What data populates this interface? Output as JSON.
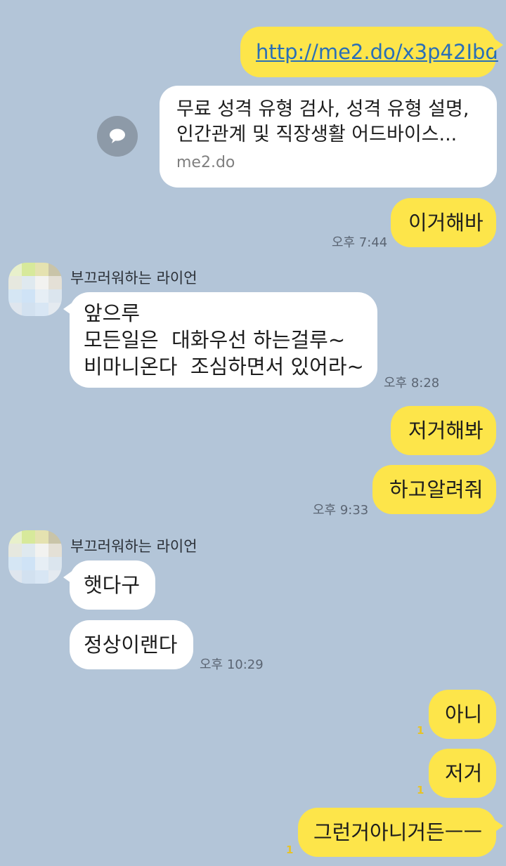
{
  "messages": {
    "m1": {
      "text": "http://me2.do/x3p42Ibd"
    },
    "preview": {
      "line1": "무료 성격 유형 검사, 성격 유형 설명,",
      "line2": "인간관계 및 직장생활 어드바이스...",
      "domain": "me2.do"
    },
    "m2": {
      "text": "이거해바",
      "time": "오후 7:44"
    },
    "sender1": "부끄러워하는 라이언",
    "m3": {
      "line1": "앞으루",
      "line2": "모든일은  대화우선 하는걸루~",
      "line3": "비마니온다  조심하면서 있어라~",
      "time": "오후 8:28"
    },
    "m4": {
      "text": "저거해봐"
    },
    "m5": {
      "text": "하고알려줘",
      "time": "오후 9:33"
    },
    "sender2": "부끄러워하는 라이언",
    "m6": {
      "text": "햇다구"
    },
    "m7": {
      "text": "정상이랜다",
      "time": "오후 10:29"
    },
    "m8": {
      "text": "아니",
      "unread": "1"
    },
    "m9": {
      "text": "저거",
      "unread": "1"
    },
    "m10": {
      "text": "그런거아니거든ㅡㅡ",
      "unread": "1"
    }
  },
  "colors": {
    "background": "#b3c5d8",
    "my_bubble": "#fde54a",
    "their_bubble": "#ffffff",
    "link": "#2a6fb7",
    "unread": "#e6c327"
  },
  "icons": {
    "share": "share-speech-bubble-icon",
    "avatar": "pixelated-avatar"
  }
}
